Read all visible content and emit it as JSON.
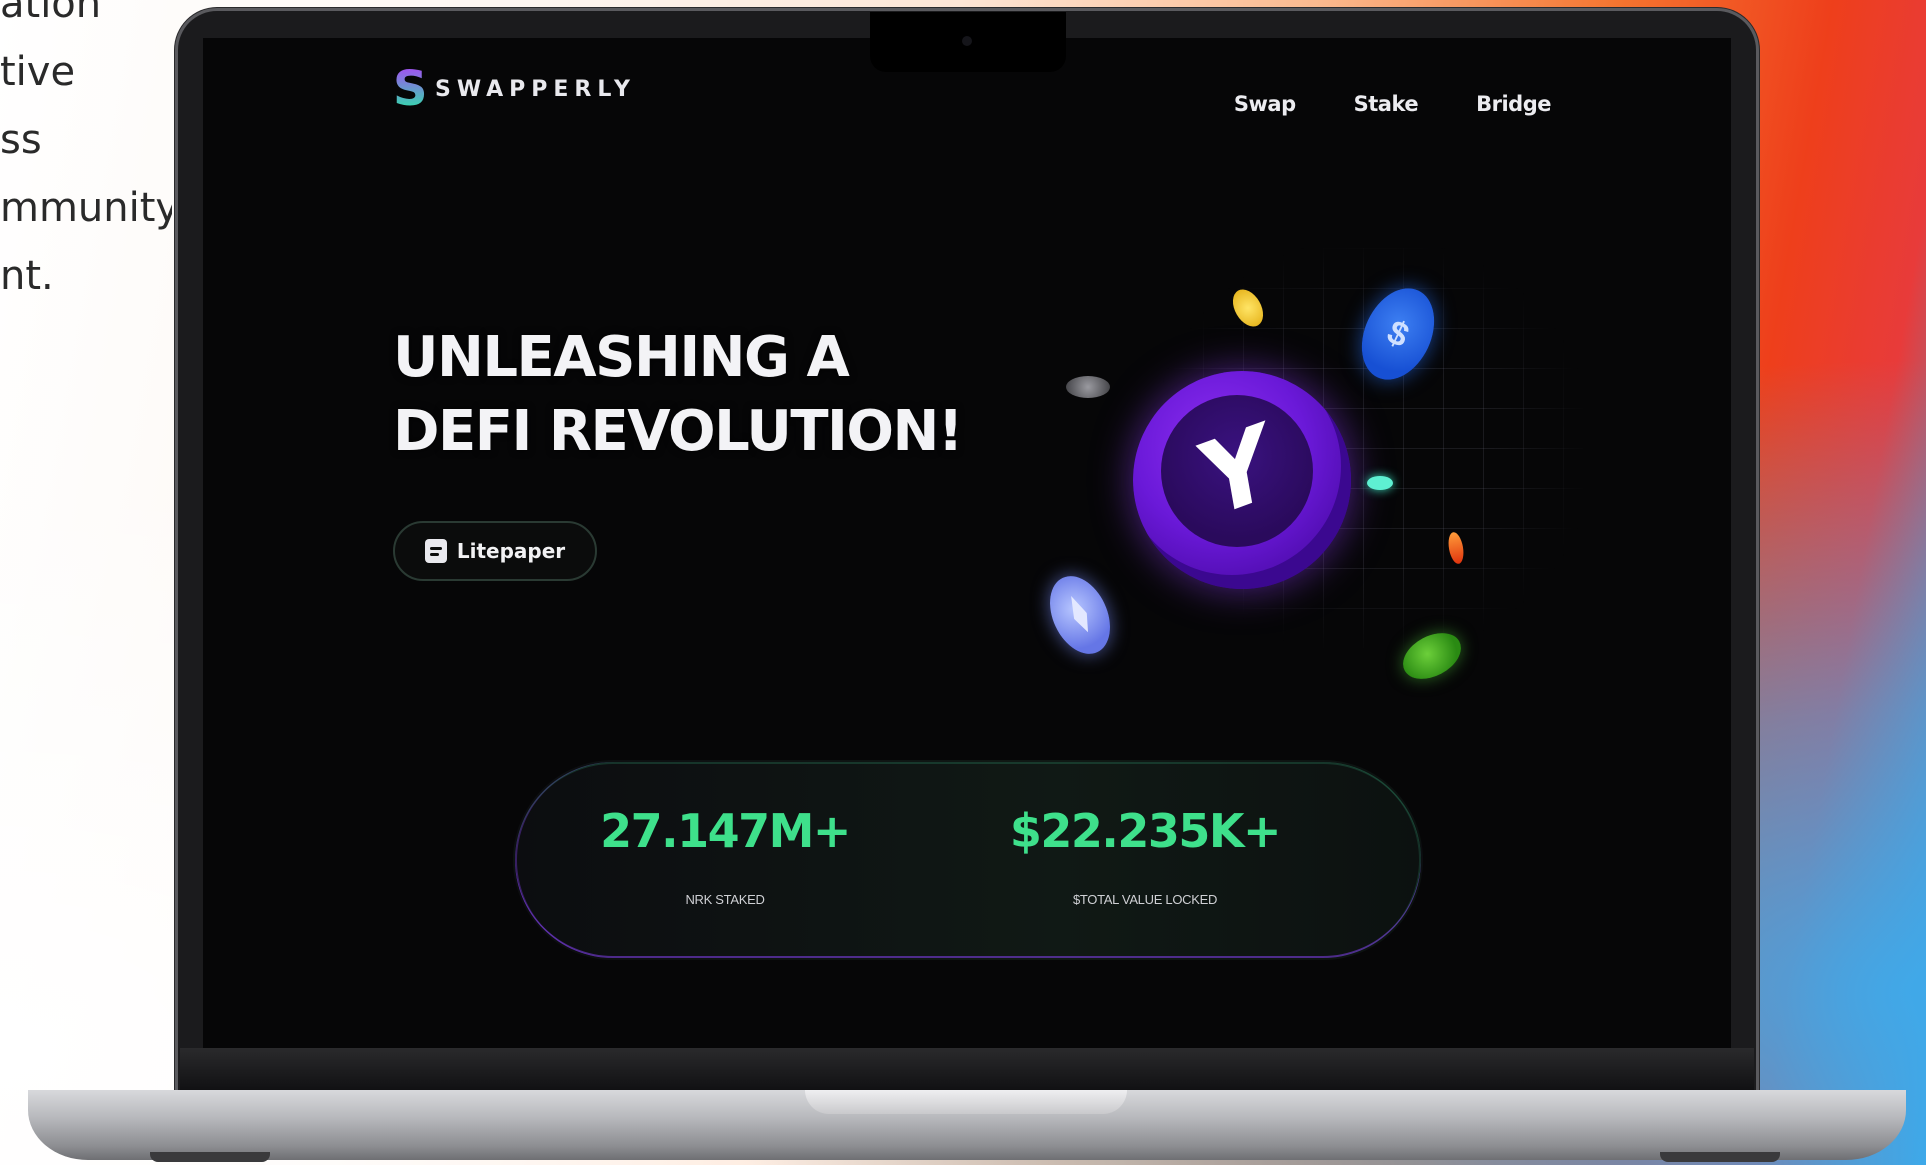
{
  "background": {
    "side_text_lines": [
      "ation",
      "tive",
      "ss",
      "mmunity",
      "nt."
    ]
  },
  "site": {
    "brand_mark": "S",
    "brand_name": "SWAPPERLY",
    "nav": [
      "Swap",
      "Stake",
      "Bridge"
    ]
  },
  "hero": {
    "line1": "UNLEASHING A",
    "line2": "DEFI REVOLUTION!",
    "cta_label": "Litepaper"
  },
  "stats": [
    {
      "value": "27.147M+",
      "label": "NRK STAKED"
    },
    {
      "value": "$22.235K+",
      "label": "$TOTAL VALUE LOCKED"
    }
  ],
  "colors": {
    "accent_green": "#3ee08b",
    "accent_purple": "#6a19d8",
    "screen_bg": "#060607"
  },
  "icons": {
    "cta_icon": "document-icon",
    "center_coin": "brand-coin-icon"
  }
}
